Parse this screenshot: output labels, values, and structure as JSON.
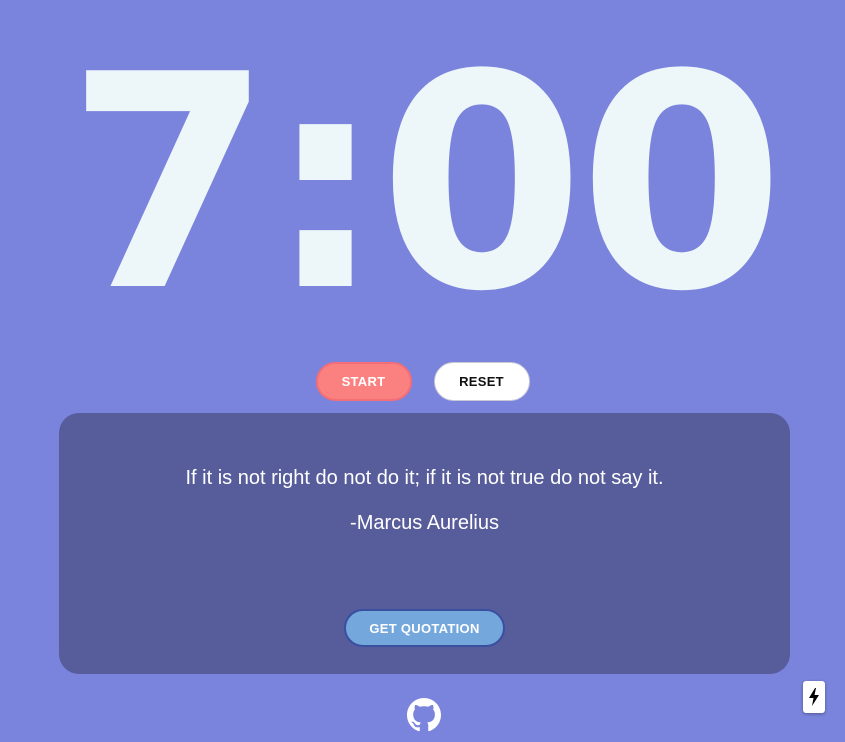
{
  "timer": {
    "display": "7:00"
  },
  "controls": {
    "start_label": "START",
    "reset_label": "RESET"
  },
  "quote": {
    "text": "If it is not right do not do it; if it is not true do not say it.",
    "author": "-Marcus Aurelius",
    "button_label": "GET QUOTATION"
  },
  "footer": {
    "icon": "github-icon",
    "badge_icon": "lightning-icon"
  },
  "colors": {
    "background": "#7a84dd",
    "timer_text": "#edf7f9",
    "start_button": "#fb8080",
    "reset_button": "#ffffff",
    "quote_card": "#575c9b",
    "quote_button": "#74a7dc"
  }
}
